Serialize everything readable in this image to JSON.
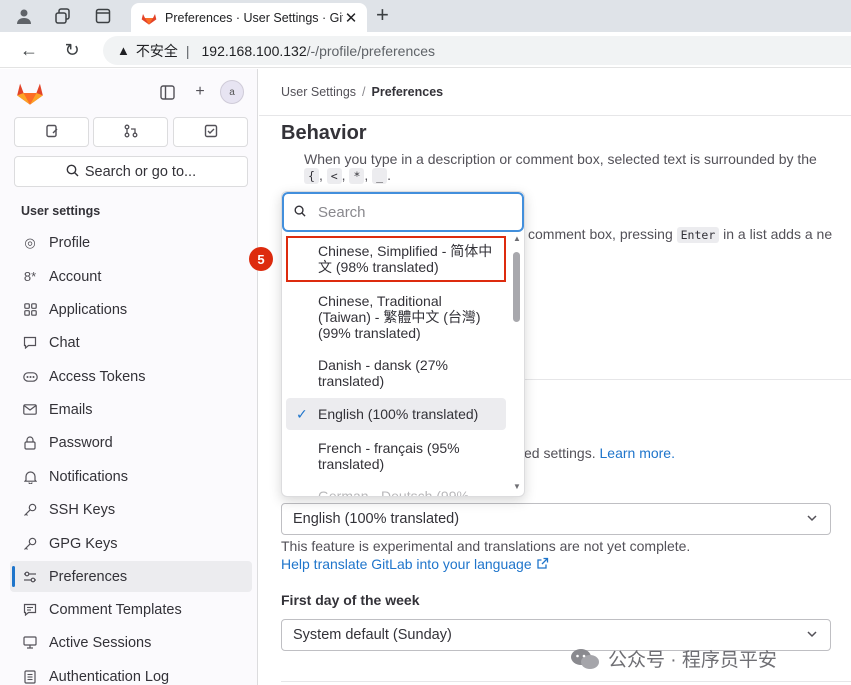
{
  "browser": {
    "tab_title": "Preferences · User Settings · GitLab",
    "insecure_label": "不安全",
    "separator": "|",
    "url_host": "192.168.100.132",
    "url_path": "/-/profile/preferences"
  },
  "sidebar": {
    "avatar_alt": "a",
    "search_label": "Search or go to...",
    "section_title": "User settings",
    "items": [
      {
        "label": "Profile",
        "icon": "user-icon"
      },
      {
        "label": "Account",
        "icon": "account-icon"
      },
      {
        "label": "Applications",
        "icon": "applications-icon"
      },
      {
        "label": "Chat",
        "icon": "chat-icon"
      },
      {
        "label": "Access Tokens",
        "icon": "token-icon"
      },
      {
        "label": "Emails",
        "icon": "mail-icon"
      },
      {
        "label": "Password",
        "icon": "lock-icon"
      },
      {
        "label": "Notifications",
        "icon": "bell-icon"
      },
      {
        "label": "SSH Keys",
        "icon": "key-icon"
      },
      {
        "label": "GPG Keys",
        "icon": "key-icon"
      },
      {
        "label": "Preferences",
        "icon": "preferences-icon",
        "active": true
      },
      {
        "label": "Comment Templates",
        "icon": "comment-icon"
      },
      {
        "label": "Active Sessions",
        "icon": "monitor-icon"
      },
      {
        "label": "Authentication Log",
        "icon": "log-icon"
      }
    ]
  },
  "main": {
    "breadcrumb_parent": "User Settings",
    "breadcrumb_separator": "/",
    "breadcrumb_current": "Preferences",
    "behavior_heading": "Behavior",
    "behavior_line1": "When you type in a description or comment box, selected text is surrounded by the",
    "keys": [
      "{",
      "<",
      "*",
      "_"
    ],
    "behavior_line2_start": "comment box, pressing",
    "behavior_line2_key": "Enter",
    "behavior_line2_end": "in a list adds a ne",
    "localization_tail": "ed settings.",
    "learn_more": "Learn more.",
    "language_value": "English (100% translated)",
    "language_hint": "This feature is experimental and translations are not yet complete.",
    "help_translate": "Help translate GitLab into your language",
    "first_day_label": "First day of the week",
    "first_day_value": "System default (Sunday)"
  },
  "dropdown": {
    "search_placeholder": "Search",
    "items": [
      {
        "label": "Chinese, Simplified - 简体中文 (98% translated)",
        "highlighted": true
      },
      {
        "label": "Chinese, Traditional (Taiwan) - 繁體中文 (台灣) (99% translated)"
      },
      {
        "label": "Danish - dansk (27% translated)"
      },
      {
        "label": "English (100% translated)",
        "selected": true
      },
      {
        "label": "French - français (95% translated)"
      },
      {
        "label": "German - Deutsch (99%"
      }
    ]
  },
  "annotation": {
    "step": "5",
    "color": "#dd2b0e"
  },
  "watermark": "公众号 · 程序员平安",
  "colors": {
    "accent": "#1f75cb",
    "highlight": "#dd2b0e",
    "focus": "#428fdc"
  }
}
